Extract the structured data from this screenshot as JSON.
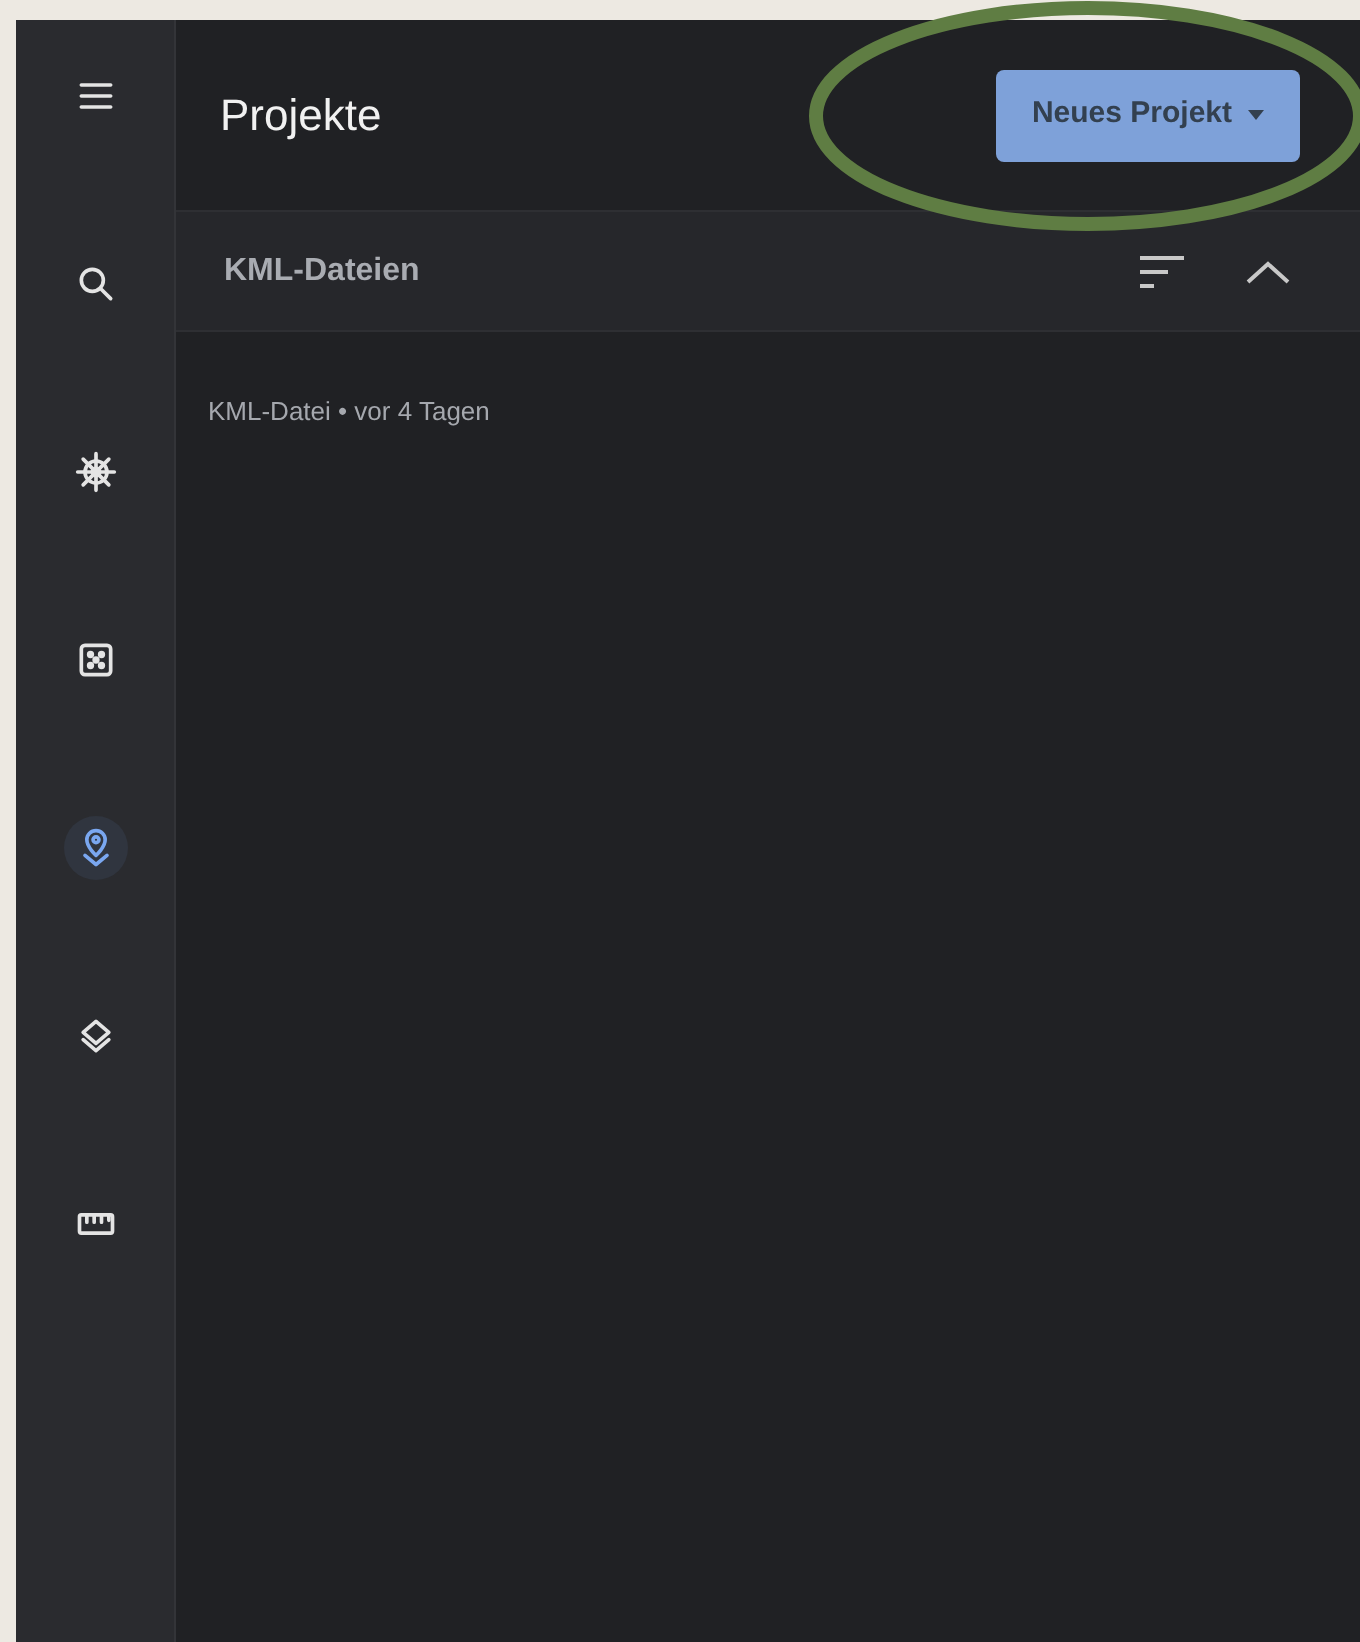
{
  "sidebar": {
    "items": [
      {
        "kind": "menu",
        "selected": false
      },
      {
        "kind": "search",
        "selected": false
      },
      {
        "kind": "wheel",
        "selected": false
      },
      {
        "kind": "dice",
        "selected": false
      },
      {
        "kind": "pin",
        "selected": true
      },
      {
        "kind": "layers",
        "selected": false
      },
      {
        "kind": "ruler",
        "selected": false
      }
    ]
  },
  "header": {
    "title": "Projekte",
    "new_button": "Neues Projekt",
    "highlighted": true
  },
  "section": {
    "title": "KML-Dateien",
    "expanded": true,
    "items": [
      {
        "label": "KML-Datei • vor 4 Tagen"
      }
    ]
  }
}
